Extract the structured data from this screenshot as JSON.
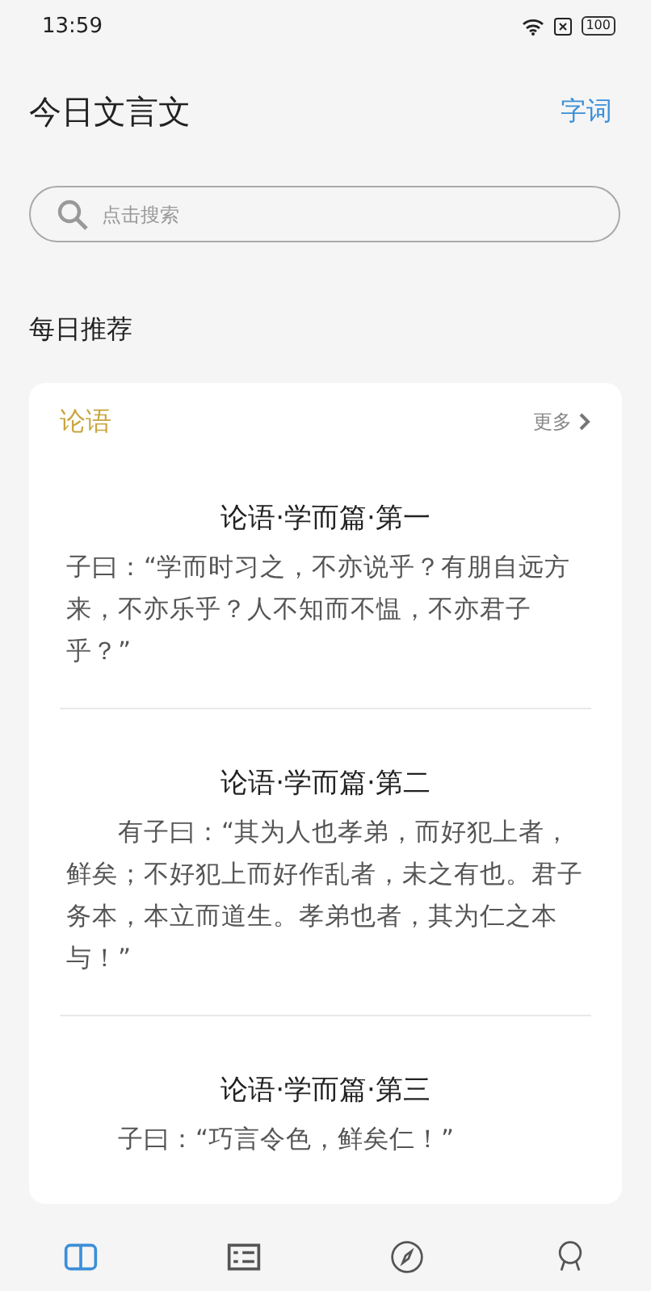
{
  "status_bar": {
    "time": "13:59",
    "battery": "100"
  },
  "header": {
    "title": "今日文言文",
    "action": "字词"
  },
  "search": {
    "placeholder": "点击搜索"
  },
  "section_title": "每日推荐",
  "card": {
    "title": "论语",
    "more": "更多",
    "passages": [
      {
        "title": "论语·学而篇·第一",
        "text": "子曰：“学而时习之，不亦说乎？有朋自远方来，不亦乐乎？人不知而不愠，不亦君子乎？”"
      },
      {
        "title": "论语·学而篇·第二",
        "text": "　　有子曰：“其为人也孝弟，而好犯上者，鲜矣；不好犯上而好作乱者，未之有也。君子务本，本立而道生。孝弟也者，其为仁之本与！”"
      },
      {
        "title": "论语·学而篇·第三",
        "text": "　　子曰：“巧言令色，鲜矣仁！”"
      }
    ]
  },
  "tab_bar": [
    {
      "kind": "book",
      "selected": true
    },
    {
      "kind": "list",
      "selected": false
    },
    {
      "kind": "compass",
      "selected": false
    },
    {
      "kind": "person",
      "selected": false
    }
  ]
}
